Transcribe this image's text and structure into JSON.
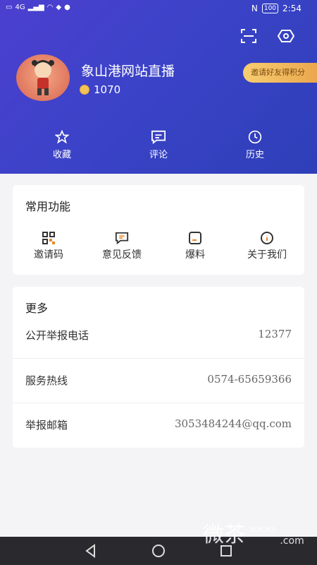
{
  "status": {
    "left_icons": [
      "sim-icon",
      "signal-icon",
      "wifi-icon",
      "app-icon",
      "message-icon"
    ],
    "carrier": "4G",
    "battery": "100",
    "time": "2:54"
  },
  "header": {
    "username": "象山港网站直播",
    "coins": "1070",
    "invite": "邀请好友得积分",
    "quick": [
      {
        "label": "收藏",
        "icon": "star-icon"
      },
      {
        "label": "评论",
        "icon": "comment-icon"
      },
      {
        "label": "历史",
        "icon": "clock-icon"
      }
    ]
  },
  "common": {
    "title": "常用功能",
    "items": [
      {
        "label": "邀请码",
        "icon": "qrcode-icon",
        "color": "#333333"
      },
      {
        "label": "意见反馈",
        "icon": "feedback-icon",
        "color": "#e8892b"
      },
      {
        "label": "爆料",
        "icon": "report-icon",
        "color": "#333333"
      },
      {
        "label": "关于我们",
        "icon": "info-icon",
        "color": "#e8892b"
      }
    ]
  },
  "more": {
    "title": "更多",
    "rows": [
      {
        "label": "公开举报电话",
        "value": "12377"
      },
      {
        "label": "服务热线",
        "value": "0574-65659366"
      },
      {
        "label": "举报邮箱",
        "value": "3053484244@qq.com"
      }
    ]
  },
  "watermark": {
    "big": "微茶",
    "small": "WXCHA",
    "domain": ".com"
  },
  "nav": [
    "back-icon",
    "home-icon",
    "recents-icon"
  ]
}
